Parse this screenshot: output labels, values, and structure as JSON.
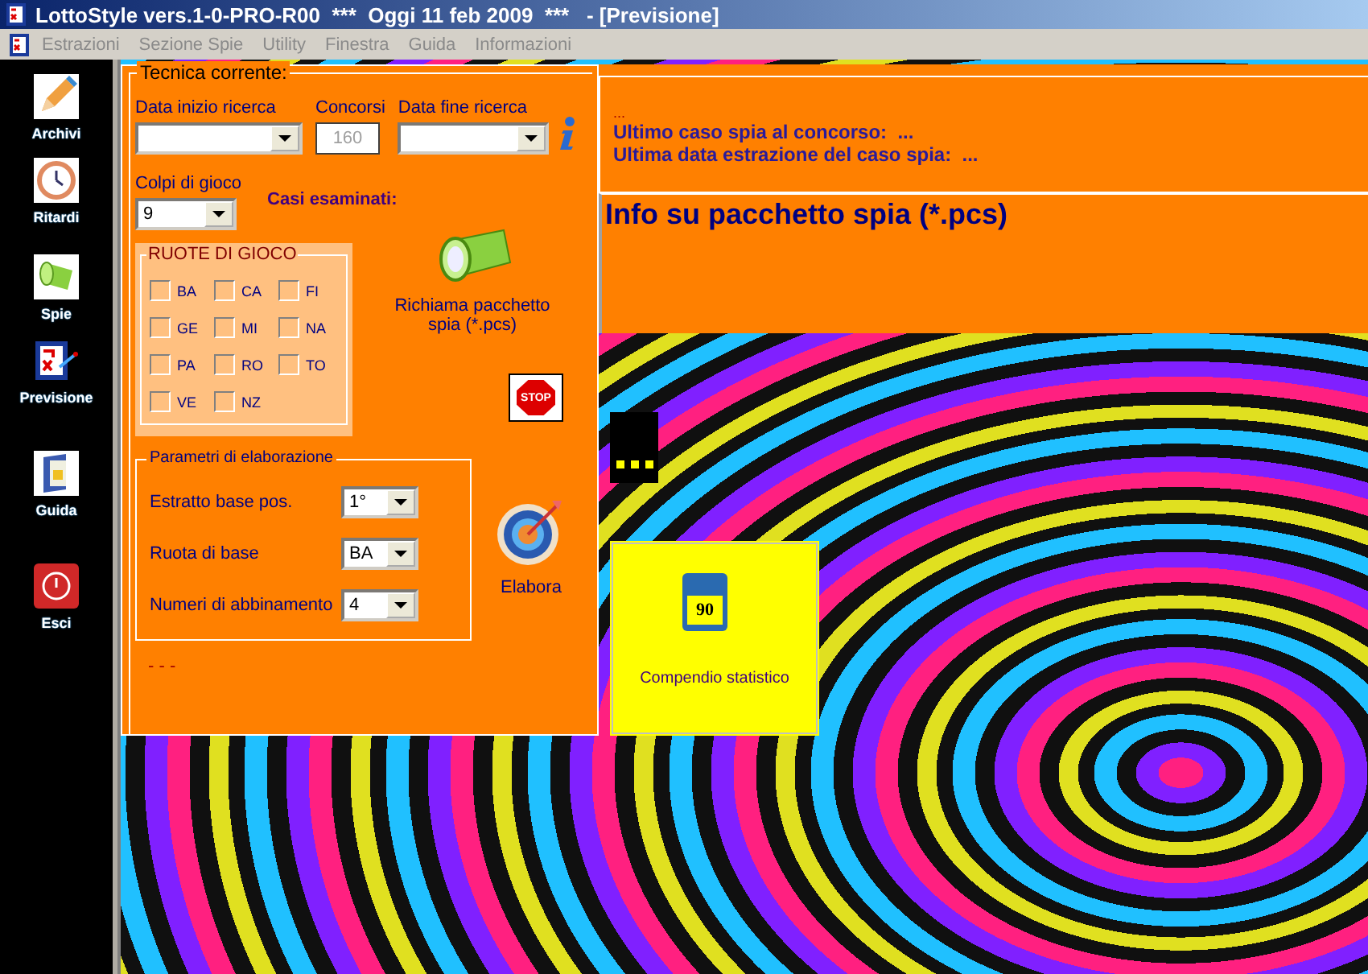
{
  "window": {
    "title": "LottoStyle vers.1-0-PRO-R00  ***  Oggi 11 feb 2009  ***   - [Previsione]"
  },
  "menu": [
    {
      "label": "Estrazioni",
      "disabled": true
    },
    {
      "label": "Sezione Spie",
      "disabled": true
    },
    {
      "label": "Utility",
      "disabled": true
    },
    {
      "label": "Finestra",
      "disabled": true
    },
    {
      "label": "Guida",
      "disabled": true
    },
    {
      "label": "Informazioni",
      "disabled": true
    }
  ],
  "sidebar": [
    {
      "label": "Archivi",
      "kind": "pencil"
    },
    {
      "label": "Ritardi",
      "kind": "clock"
    },
    {
      "label": "Spie",
      "kind": "flashlight"
    },
    {
      "label": "Previsione",
      "kind": "board"
    },
    {
      "label": "Guida",
      "kind": "book"
    },
    {
      "label": "Esci",
      "kind": "power"
    }
  ],
  "form": {
    "title": "Tecnica corrente:",
    "start_date": {
      "label": "Data inizio ricerca"
    },
    "draws": {
      "label": "Concorsi",
      "value": "160",
      "disabled": true
    },
    "end_date": {
      "label": "Data fine ricerca"
    },
    "plays": {
      "label": "Colpi di gioco",
      "value": "9"
    },
    "cases_label": "Casi esaminati:",
    "wheels": {
      "title": "RUOTE DI GIOCO",
      "items": [
        {
          "label": "BA",
          "checked": false
        },
        {
          "label": "CA",
          "checked": false
        },
        {
          "label": "FI",
          "checked": false
        },
        {
          "label": "GE",
          "checked": false
        },
        {
          "label": "MI",
          "checked": false
        },
        {
          "label": "NA",
          "checked": false
        },
        {
          "label": "PA",
          "checked": false
        },
        {
          "label": "RO",
          "checked": false
        },
        {
          "label": "TO",
          "checked": false
        },
        {
          "label": "VE",
          "checked": false
        },
        {
          "label": "NZ",
          "checked": false
        }
      ]
    },
    "load_button": "Richiama pacchetto spia (*.pcs)",
    "stop_button": "STOP",
    "params": {
      "title": "Parametri di elaborazione",
      "rows": [
        {
          "label": "Estratto base pos.",
          "value": "1°"
        },
        {
          "label": "Ruota di base",
          "value": "BA"
        },
        {
          "label": "Numeri di abbinamento",
          "value": "4"
        }
      ]
    },
    "process_button": "Elabora",
    "status": "- - -"
  },
  "results": {
    "dots": "...",
    "lines": [
      "Ultimo caso spia al concorso:  ...",
      "Ultima data estrazione del caso spia:  ..."
    ]
  },
  "info": {
    "title": "Info su pacchetto spia (*.pcs)"
  },
  "compendium": {
    "badge": "90",
    "label": "Compendio statistico"
  }
}
